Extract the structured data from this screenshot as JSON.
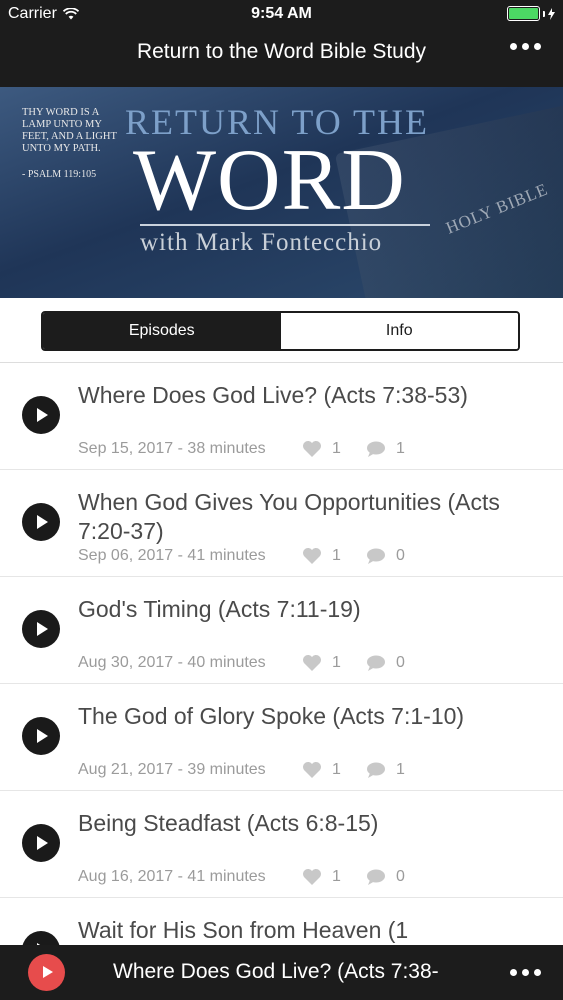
{
  "status_bar": {
    "carrier": "Carrier",
    "time": "9:54 AM",
    "battery_color": "#4cd964"
  },
  "nav": {
    "title": "Return to the Word Bible Study",
    "more_icon": "more-dots-icon"
  },
  "banner": {
    "verse": "Thy word is a lamp unto my feet, and a light unto my path.",
    "verse_ref": "- Psalm 119:105",
    "line1": "RETURN TO THE",
    "line2": "WORD",
    "line3": "with Mark Fontecchio",
    "book_text": "HOLY BIBLE"
  },
  "tabs": [
    {
      "label": "Episodes",
      "active": true
    },
    {
      "label": "Info",
      "active": false
    }
  ],
  "episodes": [
    {
      "title": "Where Does God Live? (Acts 7:38-53)",
      "meta": "Sep 15, 2017 - 38 minutes",
      "likes": "1",
      "comments": "1"
    },
    {
      "title": "When God Gives You Opportunities (Acts 7:20-37)",
      "meta": "Sep 06, 2017 - 41 minutes",
      "likes": "1",
      "comments": "0"
    },
    {
      "title": "God's Timing (Acts 7:11-19)",
      "meta": "Aug 30, 2017 - 40 minutes",
      "likes": "1",
      "comments": "0"
    },
    {
      "title": "The God of Glory Spoke (Acts 7:1-10)",
      "meta": "Aug 21, 2017 - 39 minutes",
      "likes": "1",
      "comments": "1"
    },
    {
      "title": "Being Steadfast (Acts 6:8-15)",
      "meta": "Aug 16, 2017 - 41 minutes",
      "likes": "1",
      "comments": "0"
    },
    {
      "title": "Wait for His Son from Heaven (1",
      "meta": "",
      "likes": "",
      "comments": ""
    }
  ],
  "player": {
    "title": "Where Does God Live? (Acts 7:38-",
    "accent": "#e74c4c"
  }
}
